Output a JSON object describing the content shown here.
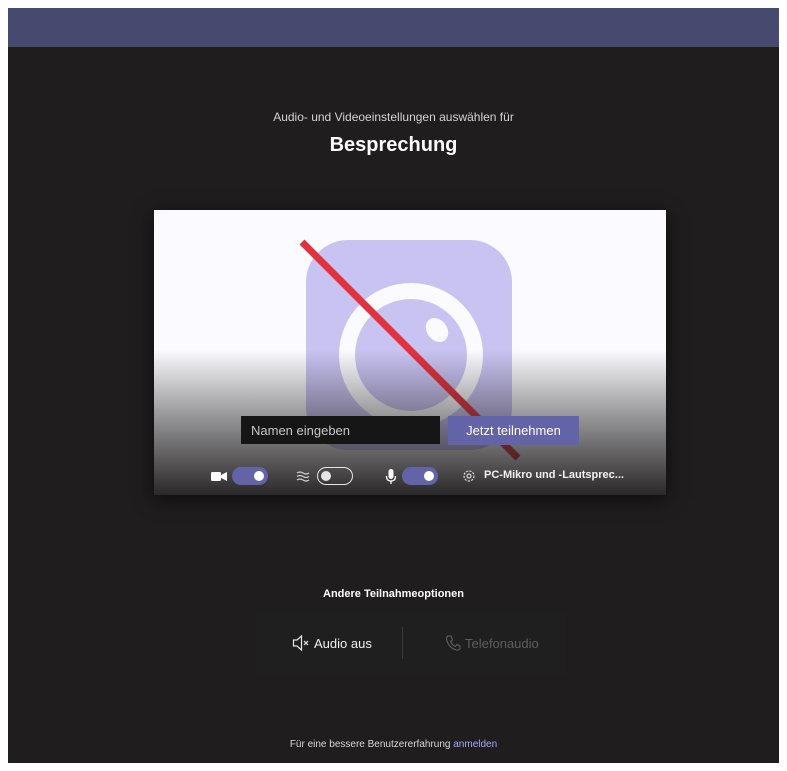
{
  "header": {
    "subtitle": "Audio- und Videoeinstellungen auswählen für",
    "meeting_title": "Besprechung"
  },
  "preview": {
    "name_placeholder": "Namen eingeben",
    "join_label": "Jetzt teilnehmen",
    "camera_icon": "camera-off-illustration"
  },
  "controls": {
    "video_on": true,
    "blur_on": false,
    "mic_on": true,
    "device_label": "PC-Mikro und -Lautsprec..."
  },
  "other_options": {
    "title": "Andere Teilnahmeoptionen",
    "audio_off": "Audio aus",
    "phone_audio": "Telefonaudio"
  },
  "footer": {
    "text": "Für eine bessere Benutzererfahrung",
    "link": "anmelden"
  },
  "colors": {
    "accent": "#6264a7",
    "background": "#1f1d1d",
    "topbar": "#474a6f",
    "slash": "#e2323f"
  }
}
